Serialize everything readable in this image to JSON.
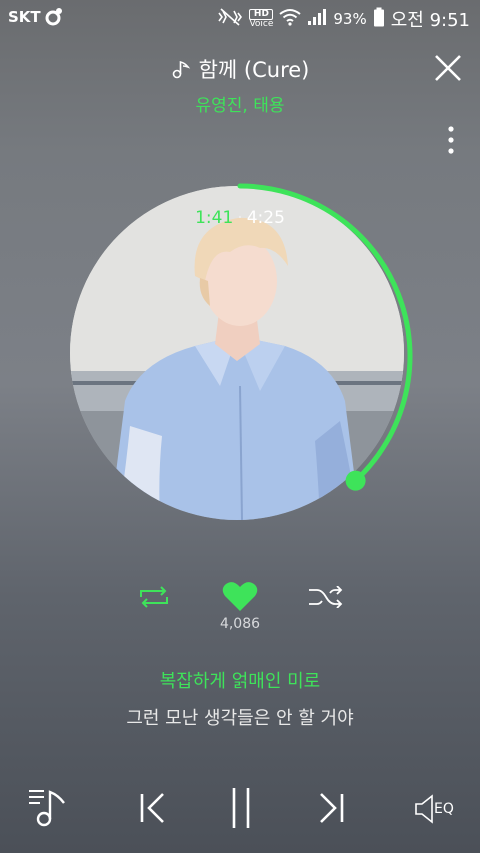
{
  "status_bar": {
    "carrier": "SKT",
    "hd_label": "HD",
    "voice_label": "Voice",
    "battery": "93%",
    "time": "오전 9:51"
  },
  "track": {
    "title": "함께 (Cure)",
    "artist": "유영진, 태용",
    "current_time": "1:41",
    "time_separator": "·",
    "duration": "4:25",
    "progress_fraction": 0.381
  },
  "actions": {
    "like_count": "4,086"
  },
  "lyrics": {
    "current": "복잡하게 얽매인 미로",
    "next": "그런 모난 생각들은 안 할 거야"
  },
  "eq_label": "EQ",
  "colors": {
    "accent": "#3ee35a"
  }
}
